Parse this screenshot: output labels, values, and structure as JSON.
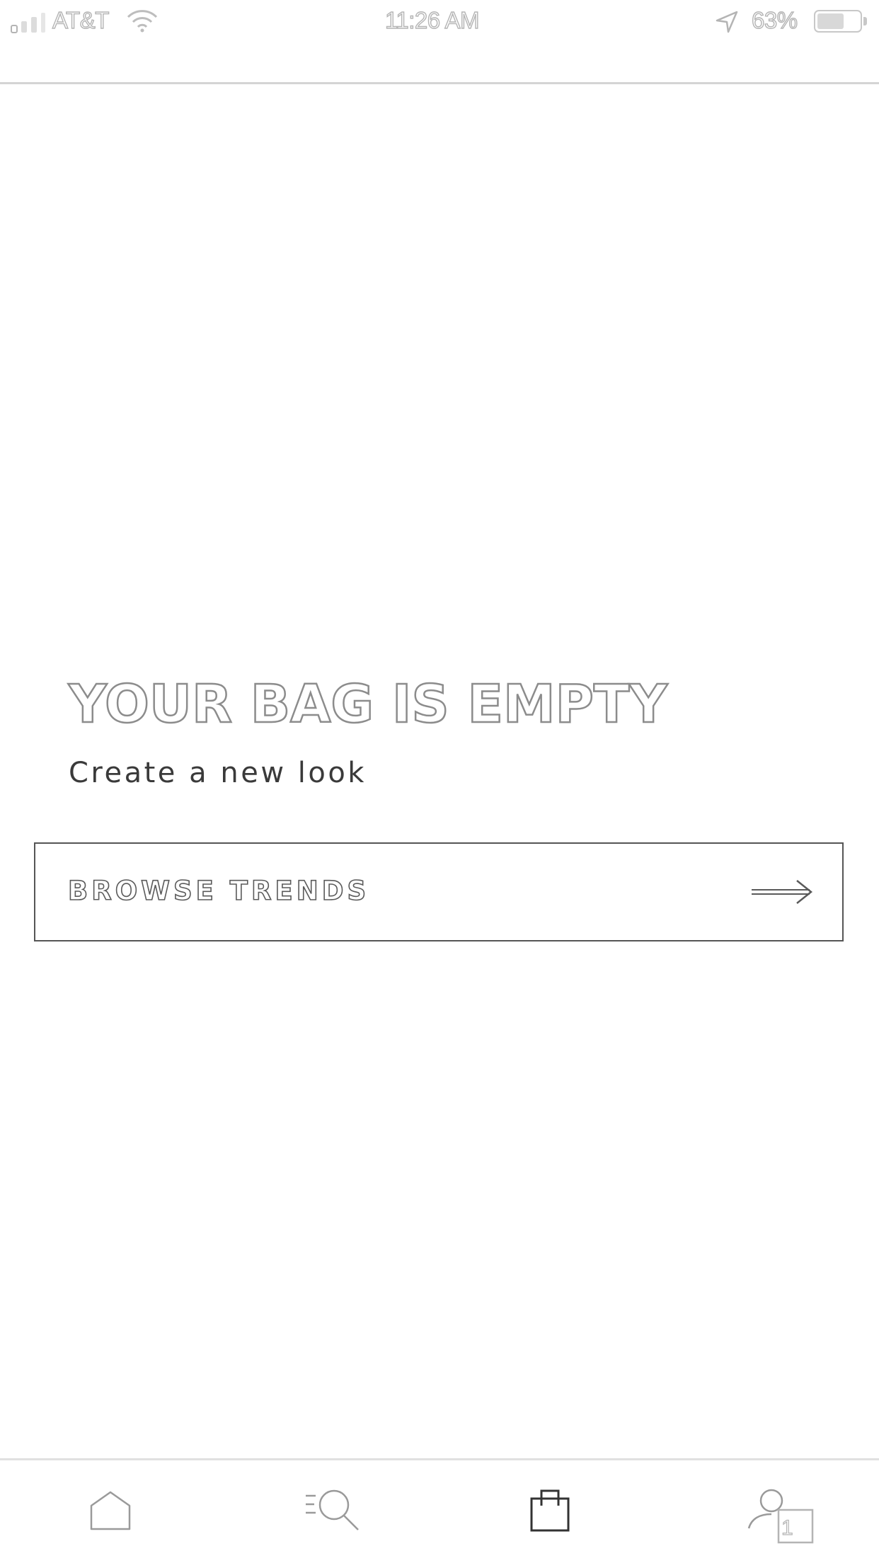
{
  "status_bar": {
    "carrier": "AT&T",
    "time": "11:26 AM",
    "battery": "63%",
    "battery_level": 0.63
  },
  "empty_state": {
    "title": "YOUR BAG IS EMPTY",
    "subtitle": "Create a new look"
  },
  "cta": {
    "label": "BROWSE TRENDS",
    "icon": "arrow-right-icon"
  },
  "tab_bar": {
    "tabs": [
      {
        "icon": "home-icon",
        "active": false
      },
      {
        "icon": "search-icon",
        "active": false
      },
      {
        "icon": "shopping-bag-icon",
        "active": true
      },
      {
        "icon": "account-icon",
        "active": false,
        "badge": "1"
      }
    ]
  }
}
